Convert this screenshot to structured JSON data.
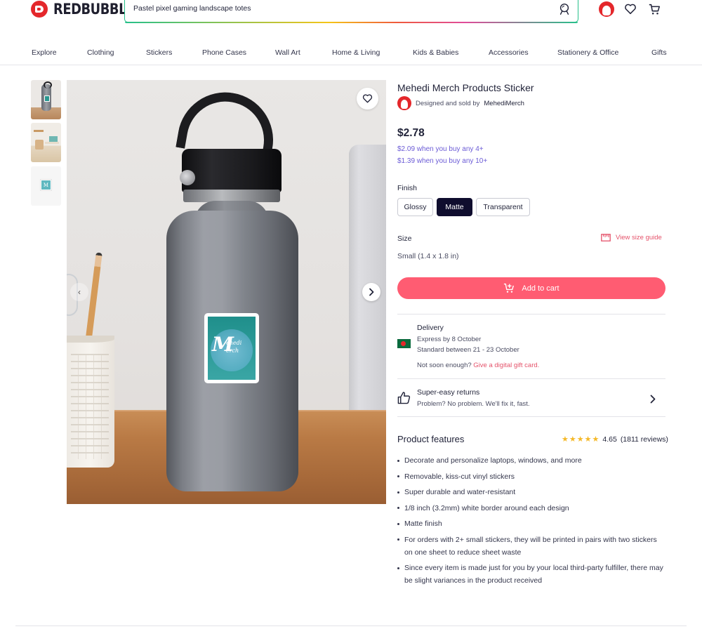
{
  "header": {
    "logo_text": "REDBUBBLE",
    "search_value": "Pastel pixel gaming landscape totes"
  },
  "nav": {
    "items": [
      "Explore",
      "Clothing",
      "Stickers",
      "Phone Cases",
      "Wall Art",
      "Home & Living",
      "Kids & Babies",
      "Accessories",
      "Stationery & Office",
      "Gifts"
    ]
  },
  "gallery": {
    "sticker_text_big": "M",
    "sticker_text_small_1": "ehedi",
    "sticker_text_small_2": "erch",
    "thumb3_text": "M"
  },
  "product": {
    "title": "Mehedi Merch Products Sticker",
    "seller_prefix": "Designed and sold by",
    "seller_name": "MehediMerch",
    "price": "$2.78",
    "bulk_4": "$2.09 when you buy any 4+",
    "bulk_10": "$1.39 when you buy any 10+",
    "finish_label": "Finish",
    "finish_options": [
      "Glossy",
      "Matte",
      "Transparent"
    ],
    "finish_selected": "Matte",
    "size_label": "Size",
    "size_guide_label": "View size guide",
    "size_value": "Small (1.4 x 1.8 in)",
    "add_to_cart": "Add to cart"
  },
  "delivery": {
    "title": "Delivery",
    "express": "Express by 8 October",
    "standard": "Standard between 21 - 23 October",
    "not_soon": "Not soon enough?",
    "gift_link": "Give a digital gift card."
  },
  "returns": {
    "title": "Super-easy returns",
    "subtitle": "Problem? No problem. We'll fix it, fast."
  },
  "features": {
    "title": "Product features",
    "rating_value": "4.65",
    "rating_count": "(1811 reviews)",
    "stars": 5,
    "items": [
      "Decorate and personalize laptops, windows, and more",
      "Removable, kiss-cut vinyl stickers",
      "Super durable and water-resistant",
      "1/8 inch (3.2mm) white border around each design",
      "Matte finish",
      "For orders with 2+ small stickers, they will be printed in pairs with two stickers on one sheet to reduce sheet waste",
      "Since every item is made just for you by your local third-party fulfiller, there may be slight variances in the product received"
    ]
  },
  "colors": {
    "brand_red": "#e4272b",
    "cta_pink": "#ff5c72",
    "link_purple": "#6b5bd6",
    "selected_navy": "#0f0d2e",
    "star_yellow": "#f5b928"
  }
}
